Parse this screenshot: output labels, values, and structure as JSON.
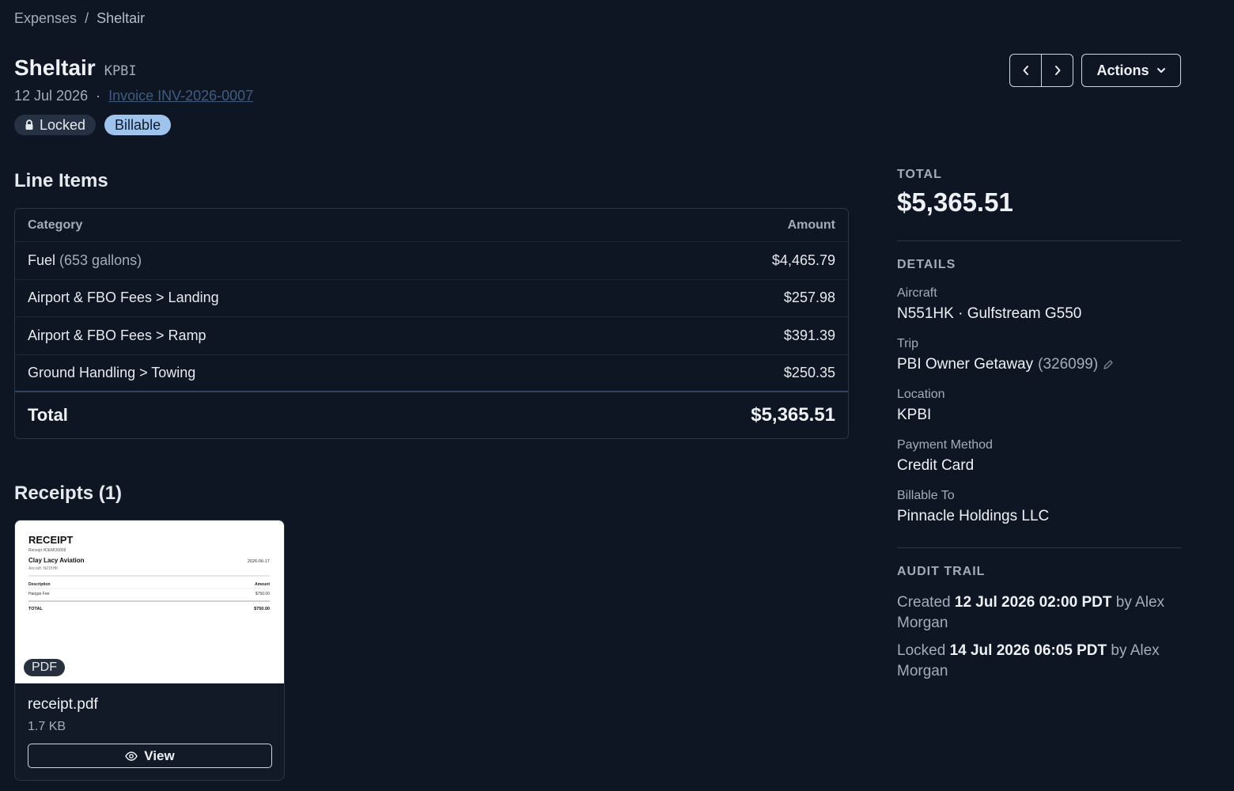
{
  "breadcrumb": {
    "parent": "Expenses",
    "separator": "/",
    "current": "Sheltair"
  },
  "header": {
    "title": "Sheltair",
    "code": "KPBI",
    "date": "12 Jul 2026",
    "dot": "·",
    "invoice_link": "Invoice INV-2026-0007",
    "badges": {
      "locked": "Locked",
      "billable": "Billable"
    },
    "actions_label": "Actions",
    "icons": {
      "prev": "chevron-left-icon",
      "next": "chevron-right-icon",
      "actions": "chevron-down-icon",
      "lock": "lock-icon"
    }
  },
  "line_items": {
    "title": "Line Items",
    "columns": {
      "category": "Category",
      "amount": "Amount"
    },
    "rows": [
      {
        "category": "Fuel",
        "note": "(653 gallons)",
        "amount": "$4,465.79"
      },
      {
        "category": "Airport & FBO Fees > Landing",
        "note": "",
        "amount": "$257.98"
      },
      {
        "category": "Airport & FBO Fees > Ramp",
        "note": "",
        "amount": "$391.39"
      },
      {
        "category": "Ground Handling > Towing",
        "note": "",
        "amount": "$250.35"
      }
    ],
    "total_label": "Total",
    "total_amount": "$5,365.51"
  },
  "receipts": {
    "title": "Receipts (1)",
    "items": [
      {
        "file_name": "receipt.pdf",
        "file_size": "1.7 KB",
        "type_badge": "PDF",
        "view_label": "View",
        "preview": {
          "heading": "RECEIPT",
          "number": "Receipt #DEMO0008",
          "vendor": "Clay Lacy Aviation",
          "date": "2026-06-17",
          "aircraft": "Aircraft: N215HK",
          "col_description": "Description",
          "col_amount": "Amount",
          "line_desc": "Hangar Fee",
          "line_amount": "$750.00",
          "total_label": "TOTAL",
          "total_amount": "$750.00"
        }
      }
    ]
  },
  "sidebar": {
    "total_label": "TOTAL",
    "total_value": "$5,365.51",
    "details_label": "DETAILS",
    "fields": {
      "aircraft": {
        "label": "Aircraft",
        "value": "N551HK · Gulfstream G550"
      },
      "trip": {
        "label": "Trip",
        "value": "PBI Owner Getaway",
        "id": "(326099)",
        "icon": "pencil-icon"
      },
      "location": {
        "label": "Location",
        "value": "KPBI"
      },
      "payment": {
        "label": "Payment Method",
        "value": "Credit Card"
      },
      "billable_to": {
        "label": "Billable To",
        "value": "Pinnacle Holdings LLC"
      }
    },
    "audit_label": "AUDIT TRAIL",
    "audit": [
      {
        "action": "Created",
        "timestamp": "12 Jul 2026 02:00 PDT",
        "by": "by Alex Morgan"
      },
      {
        "action": "Locked",
        "timestamp": "14 Jul 2026 06:05 PDT",
        "by": "by Alex Morgan"
      }
    ]
  }
}
